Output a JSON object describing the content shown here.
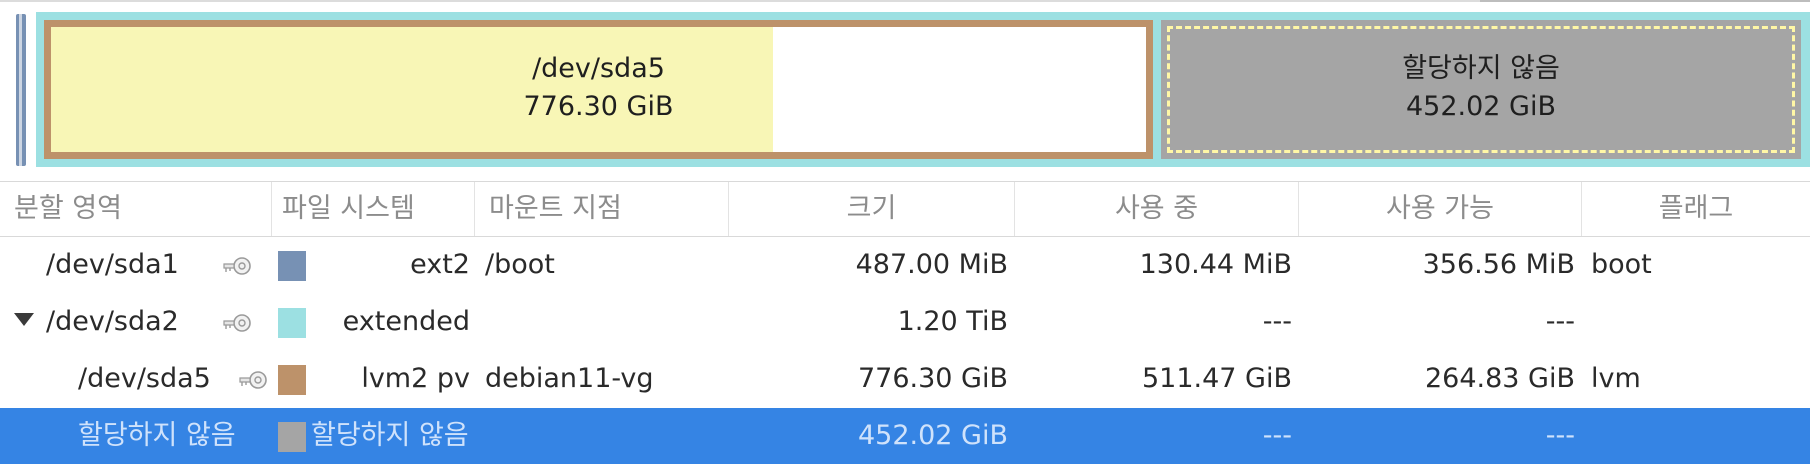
{
  "graph": {
    "sda5": {
      "name": "/dev/sda5",
      "size": "776.30 GiB",
      "used_fraction": 0.659
    },
    "unallocated": {
      "name": "할당하지 않음",
      "size": "452.02 GiB"
    }
  },
  "columns": {
    "partition": "분할 영역",
    "filesystem": "파일 시스템",
    "mountpoint": "마운트 지점",
    "size": "크기",
    "used": "사용 중",
    "free": "사용 가능",
    "flags": "플래그"
  },
  "rows": [
    {
      "partition": "/dev/sda1",
      "filesystem": "ext2",
      "mountpoint": "/boot",
      "size": "487.00 MiB",
      "used": "130.44 MiB",
      "free": "356.56 MiB",
      "flags": "boot",
      "color": "#7791b4",
      "key_icon": "key-icon"
    },
    {
      "partition": "/dev/sda2",
      "filesystem": "extended",
      "mountpoint": "",
      "size": "1.20 TiB",
      "used": "---",
      "free": "---",
      "flags": "",
      "color": "#9ce0e2",
      "key_icon": "key-icon",
      "expanded": true
    },
    {
      "partition": "/dev/sda5",
      "filesystem": "lvm2 pv",
      "mountpoint": "debian11-vg",
      "size": "776.30 GiB",
      "used": "511.47 GiB",
      "free": "264.83 GiB",
      "flags": "lvm",
      "color": "#bd926a",
      "key_icon": "key-icon"
    },
    {
      "partition": "할당하지 않음",
      "filesystem": "할당하지 않음",
      "mountpoint": "",
      "size": "452.02 GiB",
      "used": "---",
      "free": "---",
      "flags": "",
      "color": "#a5a5a5",
      "selected": true
    }
  ],
  "colors": {
    "selection": "#3584e4",
    "extended": "#9ce0e2",
    "lvm": "#bd926a",
    "used_fill": "#f8f6b6",
    "unallocated": "#a5a5a5"
  }
}
